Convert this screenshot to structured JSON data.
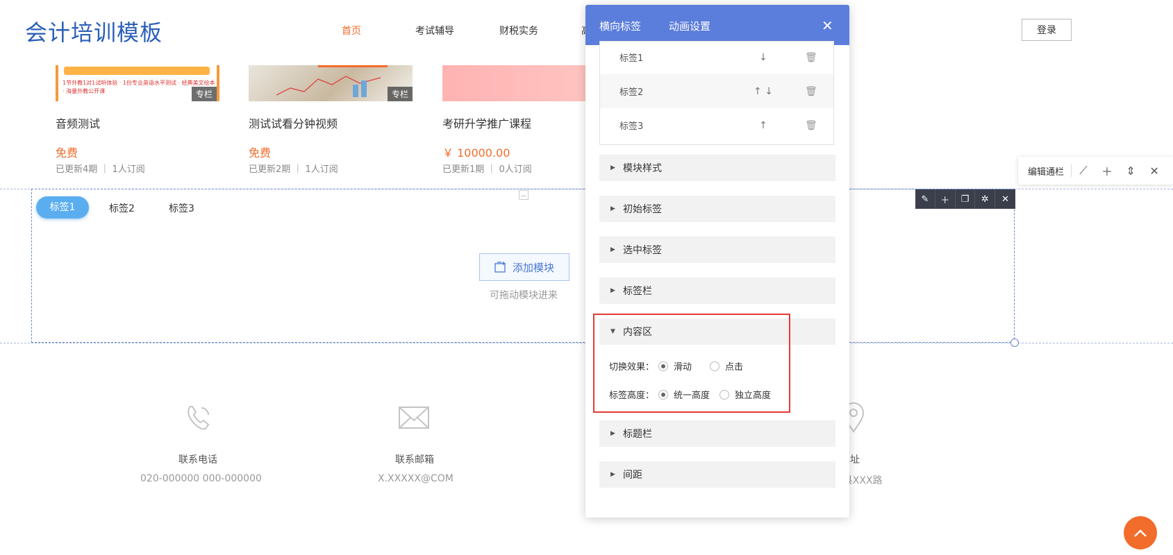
{
  "header": {
    "logo": "会计培训模板",
    "nav": [
      "首页",
      "考试辅导",
      "财税实务",
      "高"
    ],
    "login": "登录"
  },
  "courses": [
    {
      "title": "音频测试",
      "price": "免费",
      "meta": "已更新4期 ｜ 1人订阅",
      "badge": "专栏",
      "banner_text": "1节外教1对1试听体验 · 1份专业英语水平测试 · 经典美文绘本 · 海量外教公开课"
    },
    {
      "title": "测试试看分钟视频",
      "price": "免费",
      "meta": "已更新2期 ｜ 1人订阅",
      "badge": "专栏"
    },
    {
      "title": "考研升学推广课程",
      "price": "￥ 10000.00",
      "meta": "已更新1期 ｜ 0人订阅",
      "badge": ""
    }
  ],
  "tabs_module": {
    "tabs": [
      "标签1",
      "标签2",
      "标签3"
    ],
    "add_module": "添加模块",
    "drag_hint": "可拖动模块进来"
  },
  "edit_bar": {
    "label": "编辑通栏"
  },
  "footer": [
    {
      "icon": "phone-icon",
      "label": "联系电话",
      "value": "020-000000 000-000000"
    },
    {
      "icon": "mail-icon",
      "label": "联系邮箱",
      "value": "X.XXXXX@COM"
    },
    {
      "icon": "location-icon",
      "label": "地址",
      "value": "XXX县XXX路"
    }
  ],
  "panel": {
    "tabs": [
      "横向标签",
      "动画设置"
    ],
    "tag_rows": [
      {
        "name": "标签1",
        "arrows": "↓"
      },
      {
        "name": "标签2",
        "arrows": "↑  ↓"
      },
      {
        "name": "标签3",
        "arrows": "↑"
      }
    ],
    "sections": [
      "模块样式",
      "初始标签",
      "选中标签",
      "标签栏",
      "内容区",
      "标题栏",
      "间距"
    ],
    "content_area": {
      "switch_label": "切换效果：",
      "switch_options": [
        "滑动",
        "点击"
      ],
      "switch_selected": "滑动",
      "height_label": "标签高度：",
      "height_options": [
        "统一高度",
        "独立高度"
      ],
      "height_selected": "统一高度"
    }
  },
  "colors": {
    "accent": "#5b7ddb",
    "orange": "#f26c2b",
    "highlight": "#e53935",
    "pill": "#5aaef0"
  }
}
